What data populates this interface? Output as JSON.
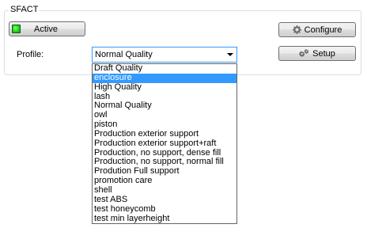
{
  "group": {
    "title": "SFACT"
  },
  "status": {
    "label": "Active",
    "led_color": "#21d321"
  },
  "buttons": {
    "configure": {
      "label": "Configure",
      "icon": "gear-icon"
    },
    "setup": {
      "label": "Setup",
      "icon": "gears-icon"
    }
  },
  "profile": {
    "label": "Profile:",
    "value": "Normal Quality",
    "options": [
      "Draft Quality",
      "enclosure",
      "High Quality",
      "lash",
      "Normal Quality",
      "owl",
      "piston",
      "Production exterior support",
      "Production exterior support+raft",
      "Production, no support, dense fill",
      "Production, no support, normal fill",
      "Prodution Full support",
      "promotion care",
      "shell",
      "test ABS",
      "test honeycomb",
      "test min layerheight"
    ],
    "highlighted": "enclosure"
  },
  "colors": {
    "highlight": "#3399ff",
    "combo_border": "#3399ff"
  }
}
